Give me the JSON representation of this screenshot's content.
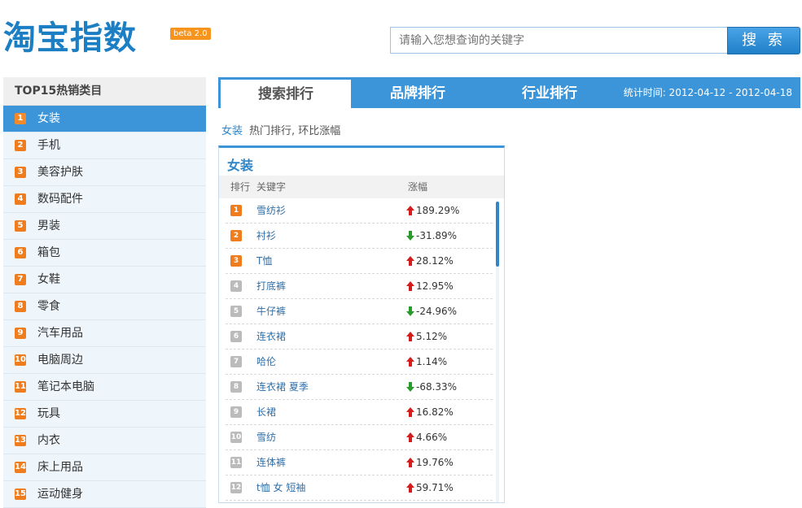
{
  "header": {
    "logo": "淘宝指数",
    "beta": "beta 2.0",
    "search_placeholder": "请输入您想查询的关键字",
    "search_button": "搜 索"
  },
  "sidebar": {
    "title": "TOP15热销类目",
    "items": [
      {
        "rank": "1",
        "label": "女装"
      },
      {
        "rank": "2",
        "label": "手机"
      },
      {
        "rank": "3",
        "label": "美容护肤"
      },
      {
        "rank": "4",
        "label": "数码配件"
      },
      {
        "rank": "5",
        "label": "男装"
      },
      {
        "rank": "6",
        "label": "箱包"
      },
      {
        "rank": "7",
        "label": "女鞋"
      },
      {
        "rank": "8",
        "label": "零食"
      },
      {
        "rank": "9",
        "label": "汽车用品"
      },
      {
        "rank": "10",
        "label": "电脑周边"
      },
      {
        "rank": "11",
        "label": "笔记本电脑"
      },
      {
        "rank": "12",
        "label": "玩具"
      },
      {
        "rank": "13",
        "label": "内衣"
      },
      {
        "rank": "14",
        "label": "床上用品"
      },
      {
        "rank": "15",
        "label": "运动健身"
      }
    ]
  },
  "tabs": [
    {
      "label": "搜索排行",
      "active": true
    },
    {
      "label": "品牌排行",
      "active": false
    },
    {
      "label": "行业排行",
      "active": false
    }
  ],
  "stat_time": "统计时间: 2012-04-12 - 2012-04-18",
  "breadcrumb": {
    "link": "女装",
    "text": "热门排行, 环比涨幅"
  },
  "panel": {
    "title": "女装",
    "columns": {
      "rank": "排行",
      "keyword": "关键字",
      "change": "涨幅"
    },
    "rows": [
      {
        "rank": "1",
        "keyword": "雪纺衫",
        "change": "189.29%",
        "dir": "up"
      },
      {
        "rank": "2",
        "keyword": "衬衫",
        "change": "-31.89%",
        "dir": "down"
      },
      {
        "rank": "3",
        "keyword": "T恤",
        "change": "28.12%",
        "dir": "up"
      },
      {
        "rank": "4",
        "keyword": "打底裤",
        "change": "12.95%",
        "dir": "up"
      },
      {
        "rank": "5",
        "keyword": "牛仔裤",
        "change": "-24.96%",
        "dir": "down"
      },
      {
        "rank": "6",
        "keyword": "连衣裙",
        "change": "5.12%",
        "dir": "up"
      },
      {
        "rank": "7",
        "keyword": "哈伦",
        "change": "1.14%",
        "dir": "up"
      },
      {
        "rank": "8",
        "keyword": "连衣裙 夏季",
        "change": "-68.33%",
        "dir": "down"
      },
      {
        "rank": "9",
        "keyword": "长裙",
        "change": "16.82%",
        "dir": "up"
      },
      {
        "rank": "10",
        "keyword": "雪纺",
        "change": "4.66%",
        "dir": "up"
      },
      {
        "rank": "11",
        "keyword": "连体裤",
        "change": "19.76%",
        "dir": "up"
      },
      {
        "rank": "12",
        "keyword": "t恤 女 短袖",
        "change": "59.71%",
        "dir": "up"
      }
    ]
  },
  "colors": {
    "accent": "#3d95d9",
    "badge": "#ef7d1d",
    "up": "#d41c1c",
    "down": "#2a9a2a"
  }
}
